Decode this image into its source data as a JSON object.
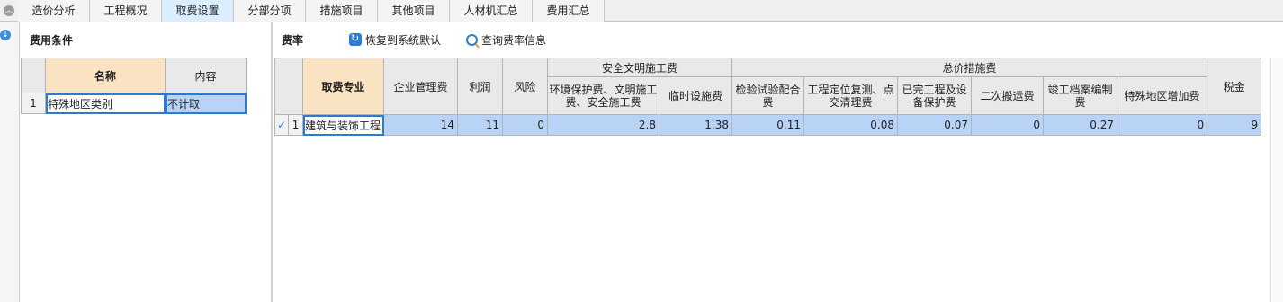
{
  "tabs": [
    {
      "label": "造价分析",
      "active": false
    },
    {
      "label": "工程概况",
      "active": false
    },
    {
      "label": "取费设置",
      "active": true
    },
    {
      "label": "分部分项",
      "active": false
    },
    {
      "label": "措施项目",
      "active": false
    },
    {
      "label": "其他项目",
      "active": false
    },
    {
      "label": "人材机汇总",
      "active": false
    },
    {
      "label": "费用汇总",
      "active": false
    }
  ],
  "left_panel": {
    "title": "费用条件",
    "headers": {
      "name": "名称",
      "content": "内容"
    },
    "rows": [
      {
        "num": "1",
        "name": "特殊地区类别",
        "content": "不计取"
      }
    ]
  },
  "right_panel": {
    "title": "费率",
    "restore_label": "恢复到系统默认",
    "query_label": "查询费率信息",
    "headers": {
      "major": "取费专业",
      "mgmt": "企业管理费",
      "profit": "利润",
      "risk": "风险",
      "safety_group": "安全文明施工费",
      "env": "环境保护费、文明施工费、安全施工费",
      "temp": "临时设施费",
      "measures_group": "总价措施费",
      "inspect": "检验试验配合费",
      "locate": "工程定位复测、点交清理费",
      "protect": "已完工程及设备保护费",
      "secondary": "二次搬运费",
      "archive": "竣工档案编制费",
      "special": "特殊地区增加费",
      "tax": "税金"
    },
    "rows": [
      {
        "num": "1",
        "checked": "✓",
        "major": "建筑与装饰工程",
        "mgmt": "14",
        "profit": "11",
        "risk": "0",
        "env": "2.8",
        "temp": "1.38",
        "inspect": "0.11",
        "locate": "0.08",
        "protect": "0.07",
        "secondary": "0",
        "archive": "0.27",
        "special": "0",
        "tax": "9"
      }
    ]
  },
  "colors": {
    "accent": "#2d7ad6",
    "selected_row": "#b9d3f7",
    "key_header": "#fae3c3",
    "active_tab": "#dbeeff"
  }
}
